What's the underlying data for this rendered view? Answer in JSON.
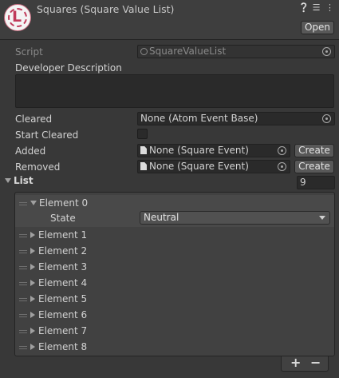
{
  "header": {
    "title": "Squares (Square Value List)",
    "icons": [
      "help-icon",
      "settings-sliders-icon",
      "kebab-menu-icon"
    ],
    "open_label": "Open"
  },
  "script": {
    "label": "Script",
    "value": "SquareValueList"
  },
  "developer_description": {
    "label": "Developer Description",
    "value": ""
  },
  "cleared": {
    "label": "Cleared",
    "value": "None (Atom Event Base)"
  },
  "start_cleared": {
    "label": "Start Cleared",
    "checked": false
  },
  "added": {
    "label": "Added",
    "value": "None (Square Event)",
    "create_label": "Create"
  },
  "removed": {
    "label": "Removed",
    "value": "None (Square Event)",
    "create_label": "Create"
  },
  "list": {
    "label": "List",
    "size": "9",
    "elements": [
      {
        "label": "Element 0",
        "expanded": true,
        "state_label": "State",
        "state_value": "Neutral"
      },
      {
        "label": "Element 1"
      },
      {
        "label": "Element 2"
      },
      {
        "label": "Element 3"
      },
      {
        "label": "Element 4"
      },
      {
        "label": "Element 5"
      },
      {
        "label": "Element 6"
      },
      {
        "label": "Element 7"
      },
      {
        "label": "Element 8"
      }
    ],
    "add_symbol": "+",
    "remove_symbol": "−"
  }
}
